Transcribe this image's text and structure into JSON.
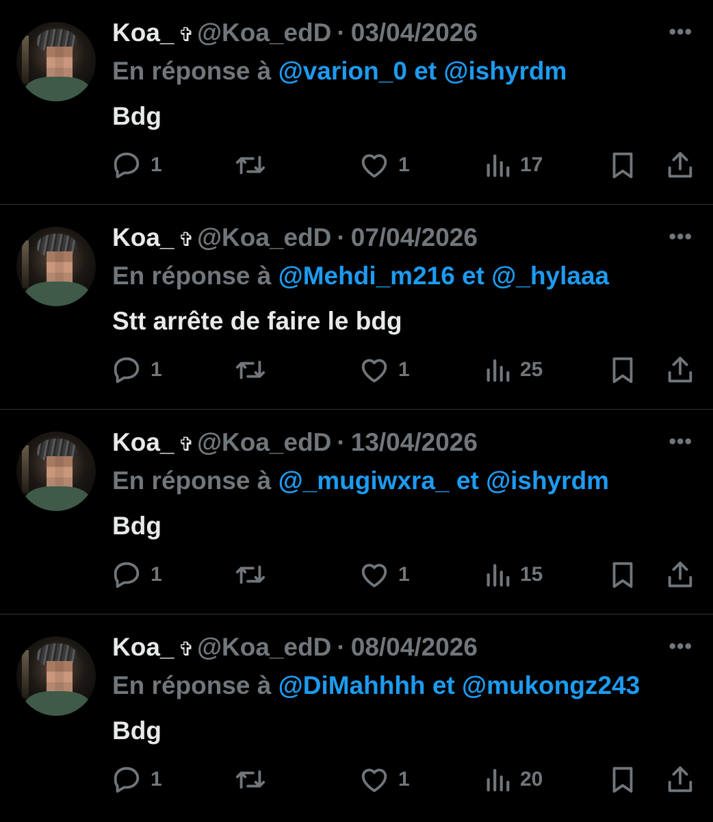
{
  "colors": {
    "background": "#000000",
    "text": "#e7e9ea",
    "muted": "#71767b",
    "link": "#1d9bf0",
    "divider": "#2f3336"
  },
  "icons": {
    "more": "more-horizontal-icon",
    "reply": "speech-bubble-icon",
    "retweet": "retweet-icon",
    "like": "heart-icon",
    "views": "bar-chart-icon",
    "bookmark": "bookmark-icon",
    "share": "share-upload-icon"
  },
  "more_label": "•••",
  "tweets": [
    {
      "display_name": "Koa_",
      "badge": "✞",
      "handle": "@Koa_edD",
      "separator": "·",
      "date": "03/04/2026",
      "reply_prefix": "En réponse à",
      "reply_user_1": "@varion_0",
      "reply_and": "et",
      "reply_user_2": "@ishyrdm",
      "text": "Bdg",
      "replies": "1",
      "likes": "1",
      "views": "17"
    },
    {
      "display_name": "Koa_",
      "badge": "✞",
      "handle": "@Koa_edD",
      "separator": "·",
      "date": "07/04/2026",
      "reply_prefix": "En réponse à",
      "reply_user_1": "@Mehdi_m216",
      "reply_and": "et",
      "reply_user_2": "@_hylaaa",
      "text": "Stt arrête de faire le bdg",
      "replies": "1",
      "likes": "1",
      "views": "25"
    },
    {
      "display_name": "Koa_",
      "badge": "✞",
      "handle": "@Koa_edD",
      "separator": "·",
      "date": "13/04/2026",
      "reply_prefix": "En réponse à",
      "reply_user_1": "@_mugiwxra_",
      "reply_and": "et",
      "reply_user_2": "@ishyrdm",
      "text": "Bdg",
      "replies": "1",
      "likes": "1",
      "views": "15"
    },
    {
      "display_name": "Koa_",
      "badge": "✞",
      "handle": "@Koa_edD",
      "separator": "·",
      "date": "08/04/2026",
      "reply_prefix": "En réponse à",
      "reply_user_1": "@DiMahhhh",
      "reply_and": "et",
      "reply_user_2": "@mukongz243",
      "text": "Bdg",
      "replies": "1",
      "likes": "1",
      "views": "20"
    }
  ]
}
